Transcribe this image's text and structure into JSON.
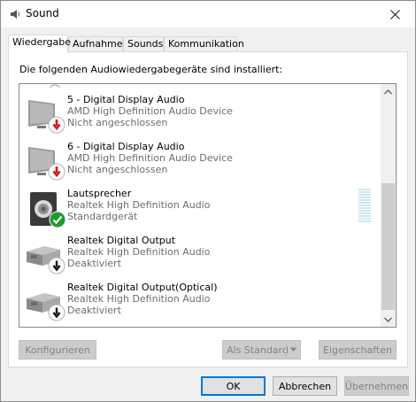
{
  "window": {
    "title": "Sound"
  },
  "tabs": [
    {
      "label": "Wiedergabe",
      "active": true
    },
    {
      "label": "Aufnahme",
      "active": false
    },
    {
      "label": "Sounds",
      "active": false
    },
    {
      "label": "Kommunikation",
      "active": false
    }
  ],
  "panel": {
    "intro": "Die folgenden Audiowiedergabegeräte sind installiert:"
  },
  "devices": [
    {
      "name": "5 - Digital Display Audio",
      "driver": "AMD High Definition Audio Device",
      "status": "Nicht angeschlossen",
      "icon": "monitor-icon",
      "badge": "disconnected"
    },
    {
      "name": "6 - Digital Display Audio",
      "driver": "AMD High Definition Audio Device",
      "status": "Nicht angeschlossen",
      "icon": "monitor-icon",
      "badge": "disconnected"
    },
    {
      "name": "Lautsprecher",
      "driver": "Realtek High Definition Audio",
      "status": "Standardgerät",
      "icon": "speaker-icon",
      "badge": "default"
    },
    {
      "name": "Realtek Digital Output",
      "driver": "Realtek High Definition Audio",
      "status": "Deaktiviert",
      "icon": "digital-output-icon",
      "badge": "disabled"
    },
    {
      "name": "Realtek Digital Output(Optical)",
      "driver": "Realtek High Definition Audio",
      "status": "Deaktiviert",
      "icon": "digital-output-icon",
      "badge": "disabled"
    }
  ],
  "buttons": {
    "configure": "Konfigurieren",
    "set_default": "Als Standard",
    "properties": "Eigenschaften",
    "ok": "OK",
    "cancel": "Abbrechen",
    "apply": "Übernehmen"
  },
  "colors": {
    "accent": "#0078d7",
    "badge_red": "#d01818",
    "badge_green": "#1f9a2e",
    "level_meter": "#cfe8ef"
  }
}
